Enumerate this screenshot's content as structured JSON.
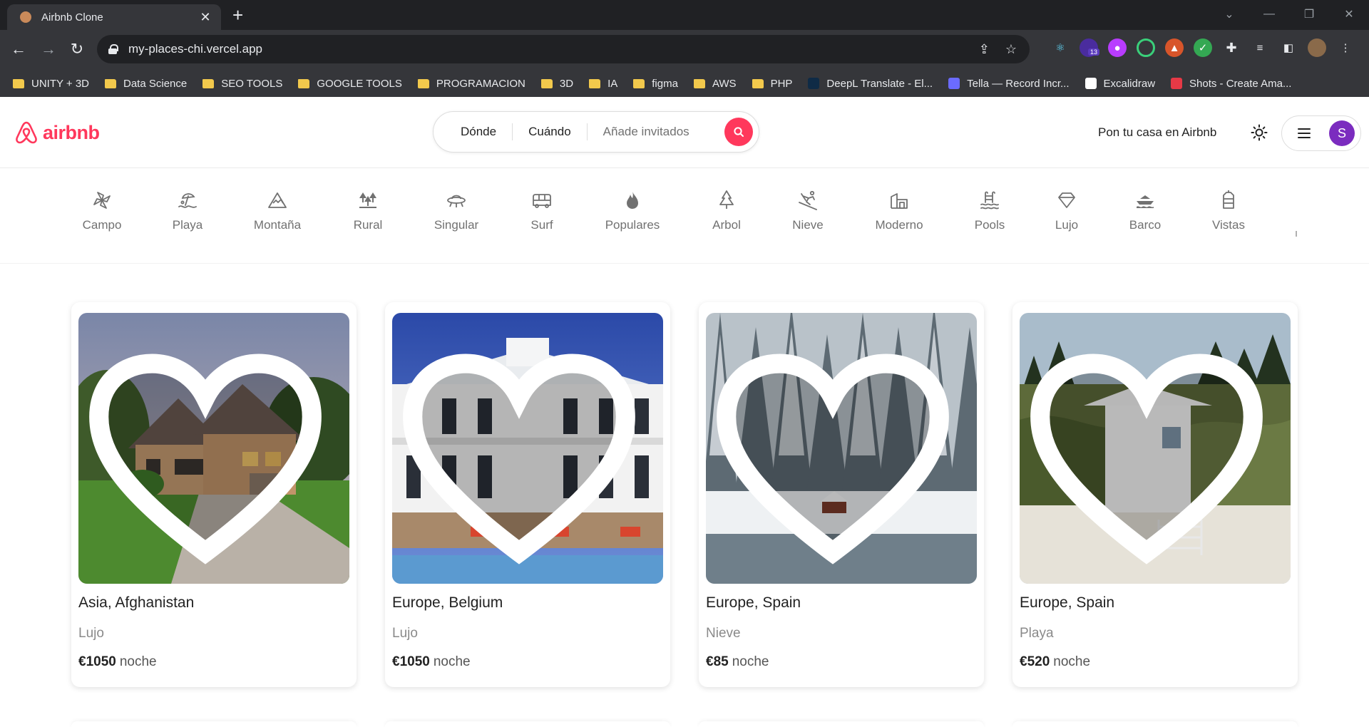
{
  "browser": {
    "tab_title": "Airbnb Clone",
    "new_tab_symbol": "+",
    "url": "my-places-chi.vercel.app",
    "extensions_badge": "13",
    "bookmarks": [
      {
        "label": "UNITY + 3D",
        "type": "folder"
      },
      {
        "label": "Data Science",
        "type": "folder"
      },
      {
        "label": "SEO TOOLS",
        "type": "folder"
      },
      {
        "label": "GOOGLE TOOLS",
        "type": "folder"
      },
      {
        "label": "PROGRAMACION",
        "type": "folder"
      },
      {
        "label": "3D",
        "type": "folder"
      },
      {
        "label": "IA",
        "type": "folder"
      },
      {
        "label": "figma",
        "type": "folder"
      },
      {
        "label": "AWS",
        "type": "folder"
      },
      {
        "label": "PHP",
        "type": "folder"
      },
      {
        "label": "DeepL Translate - El...",
        "type": "site",
        "color": "#0f2b46"
      },
      {
        "label": "Tella — Record Incr...",
        "type": "site",
        "color": "#6b6bff"
      },
      {
        "label": "Excalidraw",
        "type": "site",
        "color": "#ffffff"
      },
      {
        "label": "Shots - Create Ama...",
        "type": "site",
        "color": "#e63946"
      }
    ]
  },
  "header": {
    "logo_text": "airbnb",
    "brand_color": "#ff385c",
    "search": {
      "where": "Dónde",
      "when": "Cuándo",
      "guests": "Añade invitados"
    },
    "host_link": "Pon tu casa en Airbnb",
    "avatar_initial": "S",
    "avatar_color": "#7b2cbf"
  },
  "categories": [
    {
      "label": "Campo",
      "icon": "windmill-icon"
    },
    {
      "label": "Playa",
      "icon": "beach-umbrella-icon"
    },
    {
      "label": "Montaña",
      "icon": "mountain-icon"
    },
    {
      "label": "Rural",
      "icon": "trees-icon"
    },
    {
      "label": "Singular",
      "icon": "ufo-icon"
    },
    {
      "label": "Surf",
      "icon": "van-icon"
    },
    {
      "label": "Populares",
      "icon": "flame-icon"
    },
    {
      "label": "Arbol",
      "icon": "pine-tree-icon"
    },
    {
      "label": "Nieve",
      "icon": "skier-icon"
    },
    {
      "label": "Moderno",
      "icon": "modern-building-icon"
    },
    {
      "label": "Pools",
      "icon": "pool-icon"
    },
    {
      "label": "Lujo",
      "icon": "diamond-icon"
    },
    {
      "label": "Barco",
      "icon": "boat-icon"
    },
    {
      "label": "Vistas",
      "icon": "castle-icon"
    }
  ],
  "listings": [
    {
      "location": "Asia, Afghanistan",
      "category": "Lujo",
      "price": "€1050",
      "unit": "noche",
      "image": "brick-house-photo"
    },
    {
      "location": "Europe, Belgium",
      "category": "Lujo",
      "price": "€1050",
      "unit": "noche",
      "image": "white-villa-photo"
    },
    {
      "location": "Europe, Spain",
      "category": "Nieve",
      "price": "€85",
      "unit": "noche",
      "image": "snowy-cabin-photo"
    },
    {
      "location": "Europe, Spain",
      "category": "Playa",
      "price": "€520",
      "unit": "noche",
      "image": "beach-hut-photo"
    }
  ]
}
